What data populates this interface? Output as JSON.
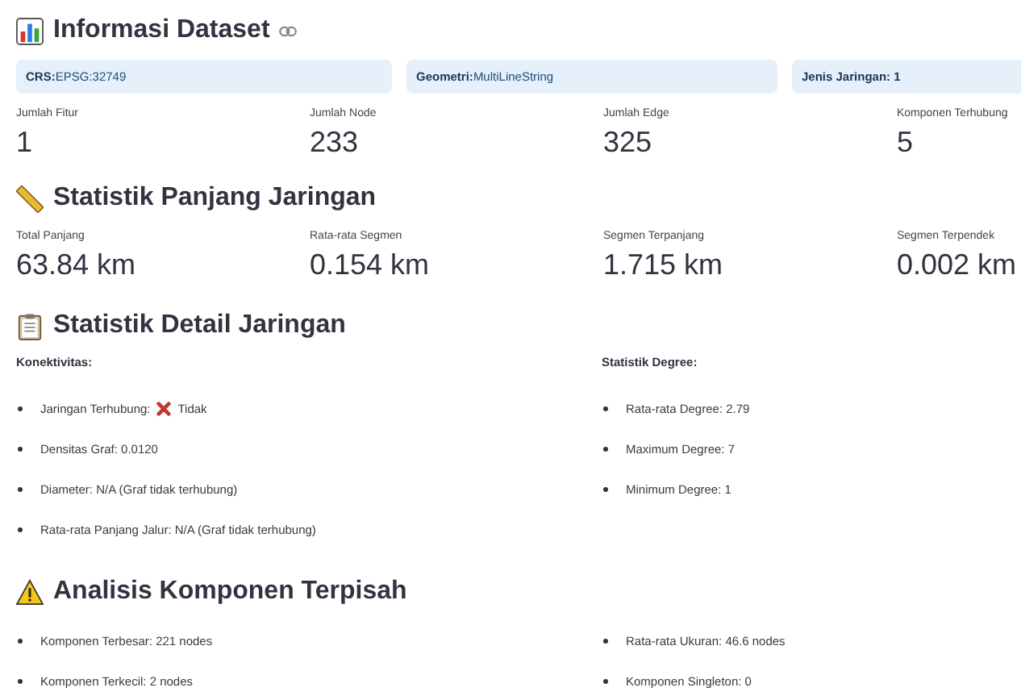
{
  "info": {
    "title": "Informasi Dataset",
    "badges": [
      {
        "label": "CRS:",
        "value": "EPSG:32749"
      },
      {
        "label": "Geometri:",
        "value": "MultiLineString"
      },
      {
        "label": "Jenis Jaringan: 1"
      }
    ],
    "metrics": [
      {
        "label": "Jumlah Fitur",
        "value": "1"
      },
      {
        "label": "Jumlah Node",
        "value": "233"
      },
      {
        "label": "Jumlah Edge",
        "value": "325"
      },
      {
        "label": "Komponen Terhubung",
        "value": "5"
      }
    ]
  },
  "length": {
    "title": "Statistik Panjang Jaringan",
    "metrics": [
      {
        "label": "Total Panjang",
        "value": "63.84 km"
      },
      {
        "label": "Rata-rata Segmen",
        "value": "0.154 km"
      },
      {
        "label": "Segmen Terpanjang",
        "value": "1.715 km"
      },
      {
        "label": "Segmen Terpendek",
        "value": "0.002 km"
      }
    ]
  },
  "detail": {
    "title": "Statistik Detail Jaringan",
    "columns": [
      {
        "heading": "Konektivitas:",
        "items": [
          {
            "text": "Jaringan Terhubung:",
            "connected": false,
            "status": "Tidak"
          },
          {
            "text": "Densitas Graf: 0.0120"
          },
          {
            "text": "Diameter: N/A (Graf tidak terhubung)"
          },
          {
            "text": "Rata-rata Panjang Jalur: N/A (Graf tidak terhubung)"
          }
        ]
      },
      {
        "heading": "Statistik Degree:",
        "items": [
          {
            "text": "Rata-rata Degree: 2.79"
          },
          {
            "text": "Maximum Degree: 7"
          },
          {
            "text": "Minimum Degree: 1"
          }
        ]
      }
    ]
  },
  "components": {
    "title": "Analisis Komponen Terpisah",
    "columns": [
      {
        "items": [
          {
            "text": "Komponen Terbesar: 221 nodes"
          },
          {
            "text": "Komponen Terkecil: 2 nodes"
          }
        ]
      },
      {
        "items": [
          {
            "text": "Rata-rata Ukuran: 46.6 nodes"
          },
          {
            "text": "Komponen Singleton: 0"
          }
        ]
      }
    ]
  }
}
